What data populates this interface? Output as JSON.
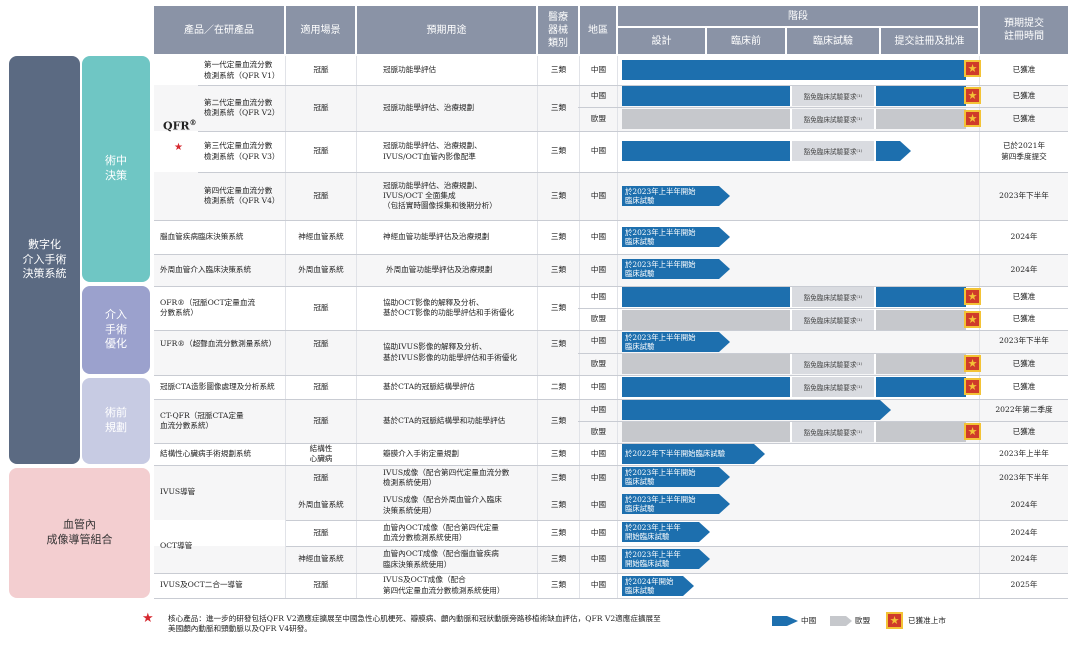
{
  "headers": {
    "product": "產品／在研產品",
    "scenario": "適用場景",
    "use": "預期用途",
    "device_class": "醫療\n器械\n類別",
    "region": "地區",
    "stage": "階段",
    "design": "設計",
    "preclinical": "臨床前",
    "clinical": "臨床試驗",
    "submission": "提交註冊及批准",
    "expected": "預期提交\n註冊時間"
  },
  "categories": {
    "digital": "數字化\n介入手術\n決策系統",
    "intra_op": "術中\n決策",
    "interventional": "介入\n手術\n優化",
    "pre_op": "術前\n規劃",
    "imaging": "血管內\n成像導管組合"
  },
  "qfr_label": "QFR",
  "reg_mark": "®",
  "star_glyph": "★",
  "flag_glyph": "★",
  "exempt_note": "豁免臨床試驗要求⁽¹⁾",
  "products": {
    "qfr_v1": "第一代定量血流分數\n檢測系統（QFR V1）",
    "qfr_v2": "第二代定量血流分數\n檢測系統（QFR V2）",
    "qfr_v3": "第三代定量血流分數\n檢測系統（QFR V3）",
    "qfr_v4": "第四代定量血流分數\n檢測系統（QFR V4）",
    "brain": "腦血管疾病臨床決策系統",
    "peripheral": "外周血管介入臨床決策系統",
    "ofr": "OFR®（冠脈OCT定量血流\n分數系統）",
    "ufr": "UFR®（超聲血流分數測量系統）",
    "cta": "冠脈CTA造影圖像處理及分析系統",
    "ctqfr": "CT-QFR（冠脈CTA定量\n血流分數系統）",
    "structural": "結構性心臟病手術規劃系統",
    "ivus": "IVUS導管",
    "oct": "OCT導管",
    "combo": "IVUS及OCT二合一導管"
  },
  "scenarios": {
    "coronary": "冠脈",
    "neuro": "神經血管系統",
    "peripheral": "外周血管系統",
    "structural": "結構性\n心臟病"
  },
  "uses": {
    "qfr_v1": "冠脈功能學評估",
    "qfr_v2": "冠脈功能學評估、治療規劃",
    "qfr_v3": "冠脈功能學評估、治療規劃、\nIVUS/OCT血管內影像配準",
    "qfr_v4": "冠脈功能學評估、治療規劃、\nIVUS/OCT 全面集成\n（包括實時圖像採集和後期分析）",
    "brain": "神經血管功能學評估及治療規劃",
    "peripheral": "外周血管功能學評估及治療規劃",
    "ofr": "協助OCT影像的解釋及分析、\n基於OCT影像的功能學評估和手術優化",
    "ufr": "協助IVUS影像的解釋及分析、\n基於IVUS影像的功能學評估和手術優化",
    "cta": "基於CTA的冠脈結構學評估",
    "ctqfr": "基於CTA的冠脈結構學和功能學評估",
    "structural": "瓣膜介入手術定量規劃",
    "ivus_cor": "IVUS成像（配合第四代定量血流分數\n檢測系統使用）",
    "ivus_per": "IVUS成像（配合外周血管介入臨床\n決策系統使用）",
    "oct_cor": "血管內OCT成像（配合第四代定量\n血流分數檢測系統使用）",
    "oct_neuro": "血管內OCT成像（配合腦血管疾病\n臨床決策系統使用）",
    "combo": "IVUS及OCT成像（配合\n第四代定量血流分數檢測系統使用）"
  },
  "classes": {
    "iii": "三類",
    "ii": "二類"
  },
  "regions": {
    "cn": "中國",
    "eu": "歐盟"
  },
  "bar_texts": {
    "h1_2023": "於2023年上半年開始\n臨床試驗",
    "h1_2023_short": "於2023年上半年\n開始臨床試驗",
    "h2_2022": "於2022年下半年開始臨床試驗",
    "y2024": "於2024年開始\n臨床試驗"
  },
  "expected": {
    "approved": "已獲准",
    "v3": "已於2021年\n第四季度提交",
    "h2_2023": "2023年下半年",
    "y2024": "2024年",
    "q2_2022": "2022年第二季度",
    "h1_2023": "2023年上半年",
    "y2025": "2025年"
  },
  "footnote": "核心產品：進一步的研發包括QFR V2適應症擴展至中國急性心肌梗死、瓣膜病、顱內動脈和冠狀動脈旁路移植術缺血評估，QFR V2適應症擴展至\n美國顱內動脈和頸動脈以及QFR V4研發。",
  "legend": {
    "china": "中國",
    "eu": "歐盟",
    "approved": "已獲准上市"
  },
  "colors": {
    "header": "#8a93a6",
    "digital": "#5b6a82",
    "intra_op": "#6fc6c4",
    "interventional": "#9ba1cd",
    "pre_op": "#c7cbe3",
    "imaging": "#f3ced0",
    "china_bar": "#1d6fae",
    "eu_bar": "#c6c8cc",
    "flag": "#cf3b2a",
    "flag_star": "#f3c336",
    "core_star": "#d6282f"
  }
}
